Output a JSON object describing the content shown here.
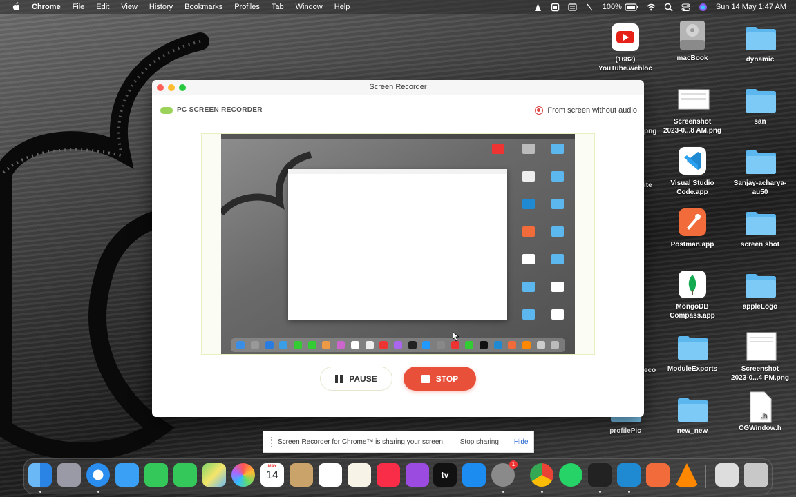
{
  "menubar": {
    "app_name": "Chrome",
    "menus": [
      "File",
      "Edit",
      "View",
      "History",
      "Bookmarks",
      "Profiles",
      "Tab",
      "Window",
      "Help"
    ],
    "battery": "100%",
    "datetime": "Sun 14 May  1:47 AM"
  },
  "desktop": {
    "icons": [
      {
        "label": "(1682)\nYouTube.webloc",
        "icon": "youtube-icon"
      },
      {
        "label": "macBook",
        "icon": "disk-icon"
      },
      {
        "label": "dynamic",
        "icon": "folder-icon"
      },
      {
        "label": "Screenshot\n2023-0...8 AM.png",
        "icon": "image-icon"
      },
      {
        "label": "san",
        "icon": "folder-icon"
      },
      {
        "label": "Visual Studio\nCode.app",
        "icon": "vscode-icon"
      },
      {
        "label": "Sanjay-acharya-\nau50",
        "icon": "folder-icon"
      },
      {
        "label": "Postman.app",
        "icon": "postman-icon"
      },
      {
        "label": "screen shot",
        "icon": "folder-icon"
      },
      {
        "label": "MongoDB\nCompass.app",
        "icon": "mongodb-icon"
      },
      {
        "label": "appleLogo",
        "icon": "folder-icon"
      },
      {
        "label": "ModuleExports",
        "icon": "folder-icon"
      },
      {
        "label": "Screenshot\n2023-0...4 PM.png",
        "icon": "image-icon"
      },
      {
        "label": "profilePic",
        "icon": "folder-icon"
      },
      {
        "label": "new_new",
        "icon": "folder-icon"
      },
      {
        "label": "CGWindow.h",
        "icon": "header-file-icon"
      }
    ],
    "partial_labels": [
      "png",
      "ite",
      "eco"
    ]
  },
  "recorder": {
    "window_title": "Screen Recorder",
    "brand": "PC SCREEN RECORDER",
    "source_label": "From screen without audio",
    "pause_label": "PAUSE",
    "stop_label": "STOP"
  },
  "share_bar": {
    "message": "Screen Recorder for Chrome™ is sharing your screen.",
    "stop_label": "Stop sharing",
    "hide_label": "Hide"
  },
  "dock": {
    "calendar_month": "MAY",
    "calendar_day": "14",
    "tv_label": "tv",
    "settings_badge": "1",
    "apps": [
      "finder-icon",
      "launchpad-icon",
      "safari-icon",
      "mail-icon",
      "facetime-icon",
      "messages-icon",
      "maps-icon",
      "photos-icon",
      "calendar-icon",
      "notes-icon",
      "reminders-icon",
      "freeform-icon",
      "music-icon",
      "podcasts-icon",
      "appletv-icon",
      "appstore-icon",
      "settings-icon",
      "chrome-icon",
      "whatsapp-icon",
      "terminal-icon",
      "vscode-icon",
      "postman-icon",
      "vlc-icon",
      "preview-icon",
      "trash-icon"
    ]
  }
}
